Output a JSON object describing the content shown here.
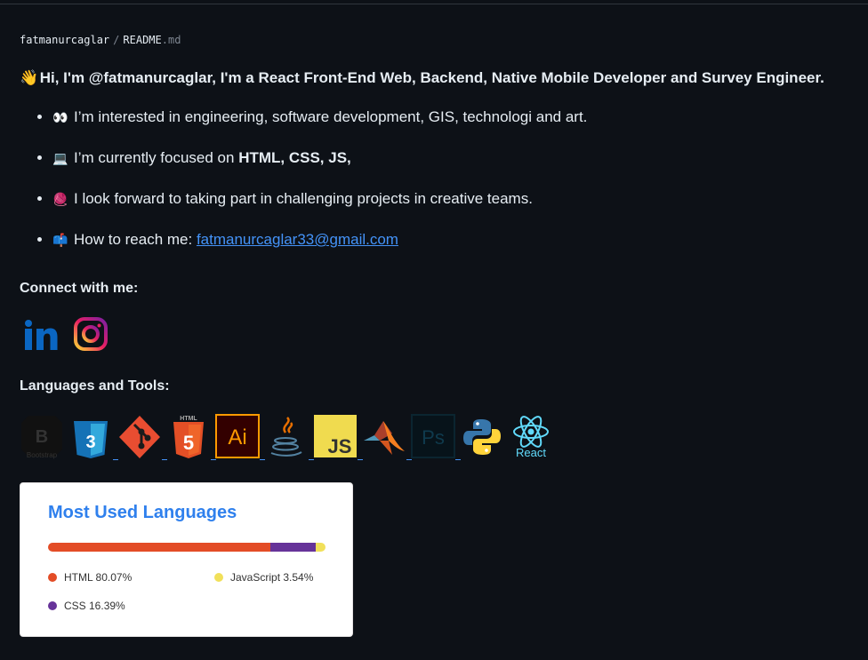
{
  "breadcrumb": {
    "user": "fatmanurcaglar",
    "separator": "/",
    "file": "README",
    "ext": ".md"
  },
  "heading": {
    "emoji": "👋",
    "text": "Hi, I'm @fatmanurcaglar, I'm a React Front-End Web, Backend, Native Mobile Developer and Survey Engineer."
  },
  "items": [
    {
      "emoji": "👀",
      "text": "I’m interested in engineering, software development, GIS, technologi and art."
    },
    {
      "emoji": "💻",
      "text": "I’m currently focused on ",
      "bold": "HTML, CSS, JS,"
    },
    {
      "emoji": "🧶",
      "text": "I look forward to taking part in challenging projects in creative teams."
    },
    {
      "emoji": "📫",
      "text": "How to reach me: ",
      "link": "fatmanurcaglar33@gmail.com"
    }
  ],
  "connect_heading": "Connect with me:",
  "tools_heading": "Languages and Tools:",
  "tools": [
    {
      "name": "bootstrap",
      "label": "Bootstrap"
    },
    {
      "name": "css3",
      "label": ""
    },
    {
      "name": "git",
      "label": ""
    },
    {
      "name": "html5",
      "label": "HTML"
    },
    {
      "name": "illustrator",
      "label": "Ai"
    },
    {
      "name": "java",
      "label": ""
    },
    {
      "name": "javascript",
      "label": "JS"
    },
    {
      "name": "matlab",
      "label": ""
    },
    {
      "name": "photoshop",
      "label": "Ps"
    },
    {
      "name": "python",
      "label": ""
    },
    {
      "name": "react",
      "label": "React"
    }
  ],
  "card": {
    "title": "Most Used Languages",
    "languages": [
      {
        "name": "HTML",
        "percent": 80.07,
        "label": "HTML 80.07%",
        "color": "#e34c26"
      },
      {
        "name": "CSS",
        "percent": 16.39,
        "label": "CSS 16.39%",
        "color": "#663399"
      },
      {
        "name": "JavaScript",
        "percent": 3.54,
        "label": "JavaScript 3.54%",
        "color": "#f1e05a"
      }
    ]
  },
  "colors": {
    "background": "#0d1117",
    "link": "#4493f8",
    "card_title": "#2f80ed"
  }
}
